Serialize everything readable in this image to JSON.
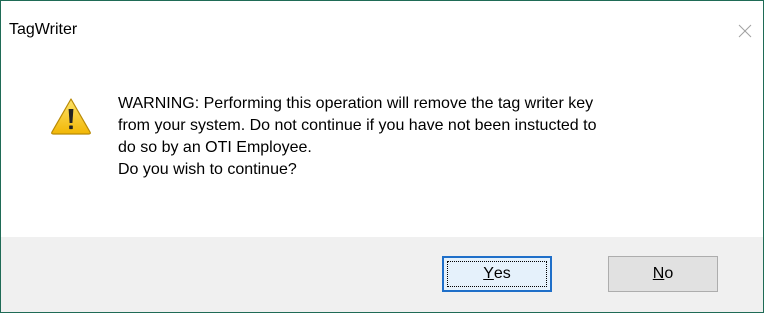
{
  "window": {
    "title": "TagWriter",
    "close_icon": "close-icon"
  },
  "message": {
    "icon": "warning-icon",
    "lines": [
      "WARNING: Performing this operation will remove the tag writer key",
      "from your system. Do not continue if you have not been instucted to",
      "do so by an OTI Employee.",
      "Do you wish to continue?"
    ]
  },
  "buttons": {
    "yes": {
      "mnemonic": "Y",
      "rest": "es"
    },
    "no": {
      "mnemonic": "N",
      "rest": "o"
    }
  },
  "colors": {
    "border": "#1f6b56",
    "footer_bg": "#f0f0f0",
    "default_button_border": "#1f6fc9",
    "warning_fill": "#f6c915"
  }
}
